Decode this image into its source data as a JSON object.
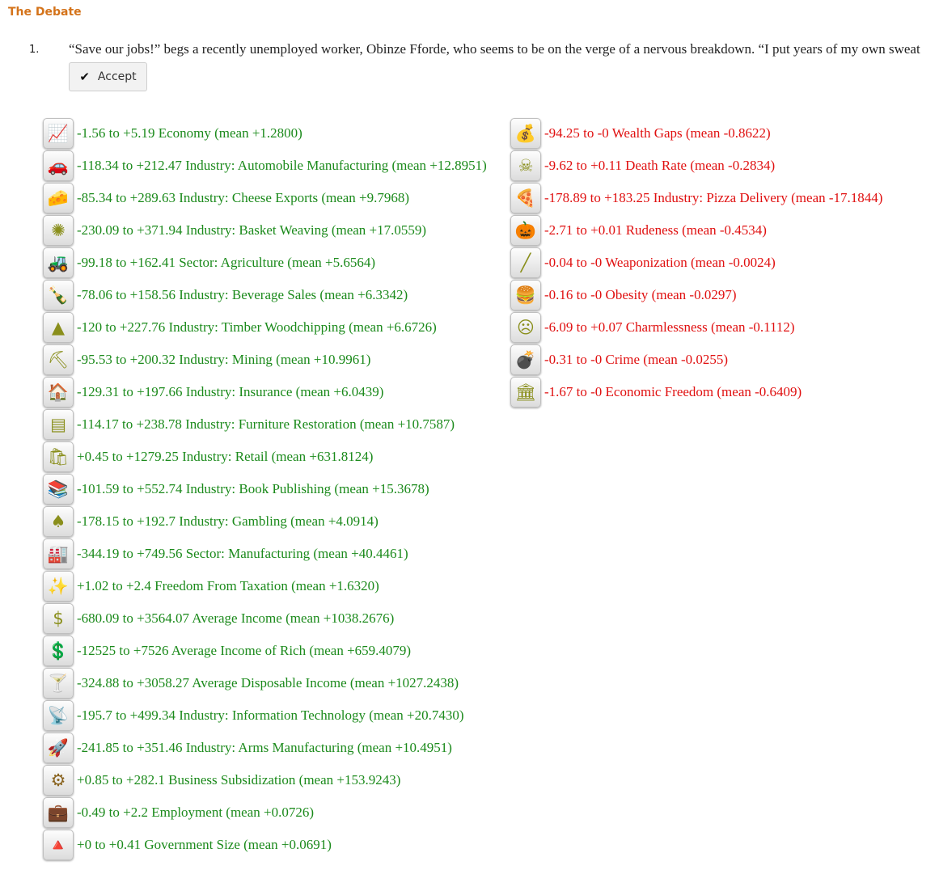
{
  "title": "The Debate",
  "option": {
    "number": "1.",
    "text": "“Save our jobs!” begs a recently unemployed worker, Obinze Fforde, who seems to be on the verge of a nervous breakdown. “I put years of my own sweat",
    "accept_label": "Accept",
    "check_icon": "✔"
  },
  "effects": {
    "positive": [
      {
        "icon": "📈",
        "icon_name": "chart-icon",
        "cls": "ic-g",
        "text": "-1.56 to +5.19 Economy (mean +1.2800)"
      },
      {
        "icon": "🚗",
        "icon_name": "car-icon",
        "cls": "ic-g",
        "text": "-118.34 to +212.47 Industry: Automobile Manufacturing (mean +12.8951)"
      },
      {
        "icon": "🧀",
        "icon_name": "cheese-icon",
        "cls": "ic-g",
        "text": "-85.34 to +289.63 Industry: Cheese Exports (mean +9.7968)"
      },
      {
        "icon": "✺",
        "icon_name": "basket-icon",
        "cls": "ic-g",
        "text": "-230.09 to +371.94 Industry: Basket Weaving (mean +17.0559)"
      },
      {
        "icon": "🚜",
        "icon_name": "tractor-icon",
        "cls": "ic-g",
        "text": "-99.18 to +162.41 Sector: Agriculture (mean +5.6564)"
      },
      {
        "icon": "🍾",
        "icon_name": "bottle-icon",
        "cls": "ic-g",
        "text": "-78.06 to +158.56 Industry: Beverage Sales (mean +6.3342)"
      },
      {
        "icon": "▲",
        "icon_name": "tree-icon",
        "cls": "ic-g",
        "text": "-120 to +227.76 Industry: Timber Woodchipping (mean +6.6726)"
      },
      {
        "icon": "⛏",
        "icon_name": "mine-cart-icon",
        "cls": "ic-g",
        "text": "-95.53 to +200.32 Industry: Mining (mean +10.9961)"
      },
      {
        "icon": "🏠",
        "icon_name": "house-icon",
        "cls": "ic-g",
        "text": "-129.31 to +197.66 Industry: Insurance (mean +6.0439)"
      },
      {
        "icon": "▤",
        "icon_name": "dresser-icon",
        "cls": "ic-g",
        "text": "-114.17 to +238.78 Industry: Furniture Restoration (mean +10.7587)"
      },
      {
        "icon": "🛍",
        "icon_name": "shopping-bag-icon",
        "cls": "ic-g",
        "text": "+0.45 to +1279.25 Industry: Retail (mean +631.8124)"
      },
      {
        "icon": "📚",
        "icon_name": "books-icon",
        "cls": "ic-g",
        "text": "-101.59 to +552.74 Industry: Book Publishing (mean +15.3678)"
      },
      {
        "icon": "♠",
        "icon_name": "spade-icon",
        "cls": "ic-g",
        "text": "-178.15 to +192.7 Industry: Gambling (mean +4.0914)"
      },
      {
        "icon": "🏭",
        "icon_name": "factory-icon",
        "cls": "ic-g",
        "text": "-344.19 to +749.56 Sector: Manufacturing (mean +40.4461)"
      },
      {
        "icon": "✨",
        "icon_name": "magic-wand-icon",
        "cls": "ic-g",
        "text": "+1.02 to +2.4 Freedom From Taxation (mean +1.6320)"
      },
      {
        "icon": "$",
        "icon_name": "dollar-icon",
        "cls": "ic-g",
        "text": "-680.09 to +3564.07 Average Income (mean +1038.2676)"
      },
      {
        "icon": "💲",
        "icon_name": "dollar-coin-icon",
        "cls": "ic-g",
        "text": "-12525 to +7526 Average Income of Rich (mean +659.4079)"
      },
      {
        "icon": "🍸",
        "icon_name": "cocktail-icon",
        "cls": "ic-g",
        "text": "-324.88 to +3058.27 Average Disposable Income (mean +1027.2438)"
      },
      {
        "icon": "📡",
        "icon_name": "satellite-dish-icon",
        "cls": "ic-g",
        "text": "-195.7 to +499.34 Industry: Information Technology (mean +20.7430)"
      },
      {
        "icon": "🚀",
        "icon_name": "rocket-icon",
        "cls": "ic-bw",
        "text": "-241.85 to +351.46 Industry: Arms Manufacturing (mean +10.4951)"
      },
      {
        "icon": "⚙",
        "icon_name": "gears-icon",
        "cls": "ic-bw",
        "text": "+0.85 to +282.1 Business Subsidization (mean +153.9243)"
      },
      {
        "icon": "💼",
        "icon_name": "briefcase-icon",
        "cls": "ic-bw",
        "text": "-0.49 to +2.2 Employment (mean +0.0726)"
      },
      {
        "icon": "🔺",
        "icon_name": "pyramid-icon",
        "cls": "ic-g",
        "text": "+0 to +0.41 Government Size (mean +0.0691)"
      }
    ],
    "negative": [
      {
        "icon": "💰",
        "icon_name": "money-bags-icon",
        "cls": "ic-g",
        "text": "-94.25 to -0 Wealth Gaps (mean -0.8622)"
      },
      {
        "icon": "☠",
        "icon_name": "skull-icon",
        "cls": "ic-g",
        "text": "-9.62 to +0.11 Death Rate (mean -0.2834)"
      },
      {
        "icon": "🍕",
        "icon_name": "pizza-icon",
        "cls": "ic-g",
        "text": "-178.89 to +183.25 Industry: Pizza Delivery (mean -17.1844)"
      },
      {
        "icon": "🎃",
        "icon_name": "pumpkin-icon",
        "cls": "ic-g",
        "text": "-2.71 to +0.01 Rudeness (mean -0.4534)"
      },
      {
        "icon": "╱",
        "icon_name": "stick-icon",
        "cls": "ic-g",
        "text": "-0.04 to -0 Weaponization (mean -0.0024)"
      },
      {
        "icon": "🍔",
        "icon_name": "fast-food-icon",
        "cls": "ic-g",
        "text": "-0.16 to -0 Obesity (mean -0.0297)"
      },
      {
        "icon": "☹",
        "icon_name": "gas-mask-icon",
        "cls": "ic-g",
        "text": "-6.09 to +0.07 Charmlessness (mean -0.1112)"
      },
      {
        "icon": "💣",
        "icon_name": "bomb-icon",
        "cls": "ic-dk",
        "text": "-0.31 to -0 Crime (mean -0.0255)"
      },
      {
        "icon": "🏛",
        "icon_name": "freedom-monument-icon",
        "cls": "ic-g",
        "text": "-1.67 to -0 Economic Freedom (mean -0.6409)"
      }
    ]
  }
}
